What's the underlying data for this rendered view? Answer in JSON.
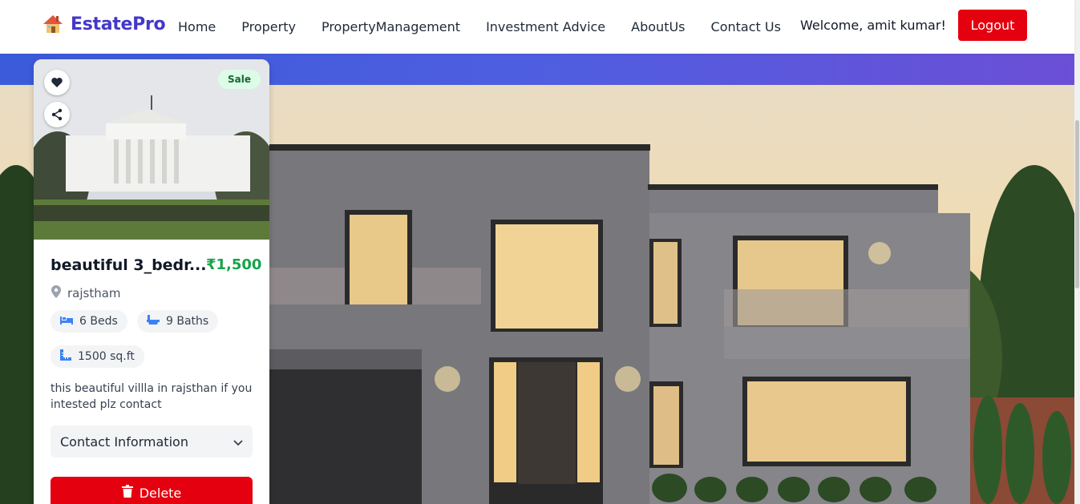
{
  "brand": {
    "name": "EstatePro",
    "icon": "house-icon"
  },
  "nav": {
    "links": [
      "Home",
      "Property",
      "PropertyManagement",
      "Investment Advice",
      "AboutUs",
      "Contact Us"
    ],
    "welcome": "Welcome, amit kumar!",
    "logout_label": "Logout"
  },
  "colors": {
    "brand": "#4338ca",
    "logout": "#e5000f",
    "price": "#16a34a",
    "hero_band_start": "#3b5bdb",
    "hero_band_end": "#6b4fd6"
  },
  "card": {
    "badge": "Sale",
    "title": "beautiful 3_bedr...",
    "price": "₹1,500",
    "location": "rajstham",
    "beds": "6 Beds",
    "baths": "9 Baths",
    "area": "1500 sq.ft",
    "description": "this beautiful villla in rajsthan if you intested plz contact",
    "contact_label": "Contact Information",
    "delete_label": "Delete"
  }
}
